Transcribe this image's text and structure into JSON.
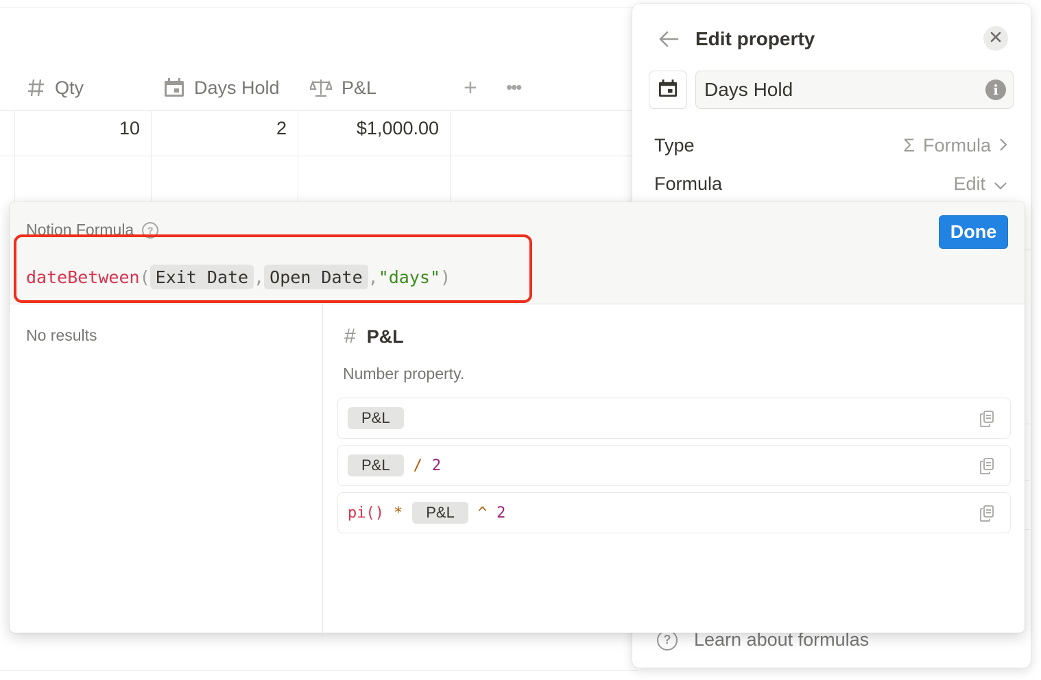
{
  "table": {
    "columns": [
      {
        "icon": "hash-icon",
        "label": "Qty"
      },
      {
        "icon": "calendar-icon",
        "label": "Days Hold"
      },
      {
        "icon": "scale-icon",
        "label": "P&L"
      }
    ],
    "add_symbol": "+",
    "more_symbol": "•••",
    "row": {
      "qty": "10",
      "days_hold": "2",
      "pnl": "$1,000.00"
    }
  },
  "edit_property": {
    "title": "Edit property",
    "name_value": "Days Hold",
    "info_symbol": "i",
    "type_label": "Type",
    "type_value": "Formula",
    "type_symbol": "Σ",
    "formula_label": "Formula",
    "formula_value": "Edit",
    "learn_label": "Learn about formulas"
  },
  "formula_editor": {
    "label": "Notion Formula",
    "done_label": "Done",
    "expression": {
      "function": "dateBetween",
      "open_paren": "(",
      "arg1": "Exit Date",
      "comma": ",",
      "arg2": "Open Date",
      "arg3": "\"days\"",
      "close_paren": ")"
    },
    "no_results": "No results",
    "detail": {
      "title": "P&L",
      "description": "Number property."
    },
    "examples": [
      {
        "chip": "P&L"
      },
      {
        "chip": "P&L",
        "op": "/",
        "num": "2"
      },
      {
        "fn": "pi()",
        "op1": "*",
        "chip": "P&L",
        "op2": "^",
        "num": "2"
      }
    ]
  },
  "colors": {
    "accent_blue": "#2383e2",
    "highlight_red": "#ef2f1b",
    "function_pink": "#d9334f",
    "string_green": "#3b8c1c"
  }
}
